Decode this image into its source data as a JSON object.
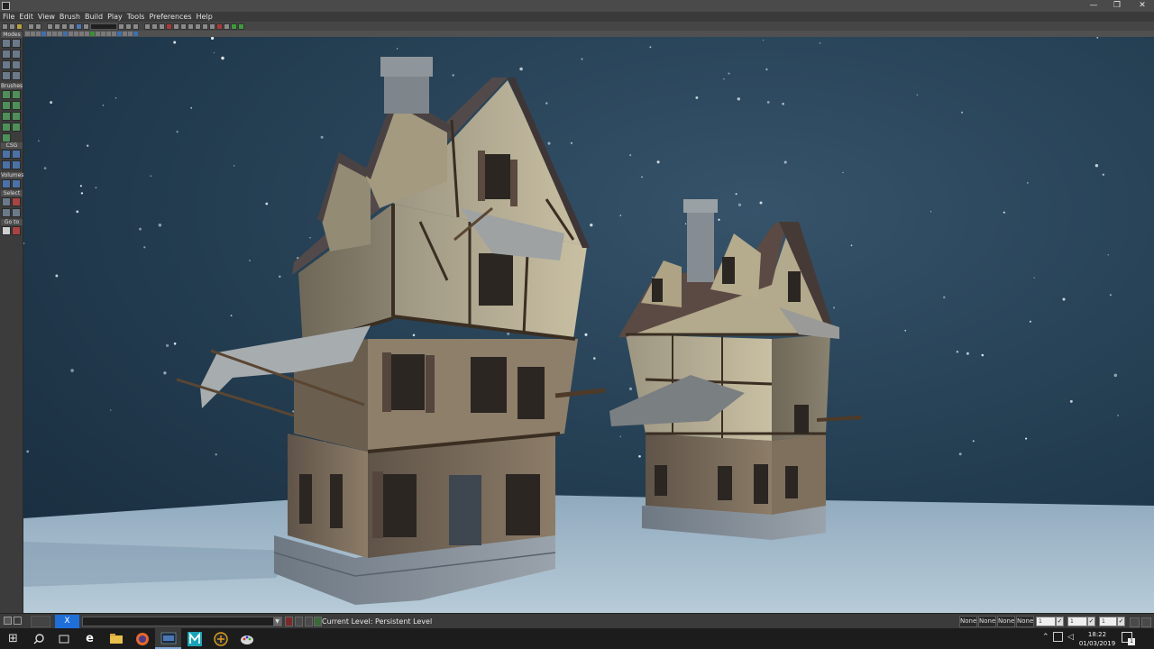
{
  "window": {
    "min_glyph": "—",
    "max_glyph": "❐",
    "close_glyph": "✕"
  },
  "menu": [
    "File",
    "Edit",
    "View",
    "Brush",
    "Build",
    "Play",
    "Tools",
    "Preferences",
    "Help"
  ],
  "left_panel": {
    "headers": [
      "Modes",
      "Brushes",
      "CSG",
      "Volumes",
      "Select",
      "Go to"
    ]
  },
  "status": {
    "tab_close_label": "X",
    "combo_arrow": "▼",
    "current_level": "Current Level:  Persistent Level",
    "none_labels": [
      "None",
      "None",
      "None",
      "None"
    ],
    "fields": [
      "1",
      "1",
      "1"
    ],
    "checks": [
      "✓",
      "✓",
      "✓"
    ]
  },
  "taskbar": {
    "clock_time": "18:22",
    "clock_date": "01/03/2019",
    "notif_count": "1",
    "apps": [
      "windows-start",
      "search",
      "task-view",
      "edge",
      "file-explorer",
      "firefox",
      "udk",
      "maya",
      "script",
      "paint"
    ]
  },
  "icons": {
    "close": "close-icon",
    "minimize": "minimize-icon",
    "maximize": "maximize-icon"
  }
}
